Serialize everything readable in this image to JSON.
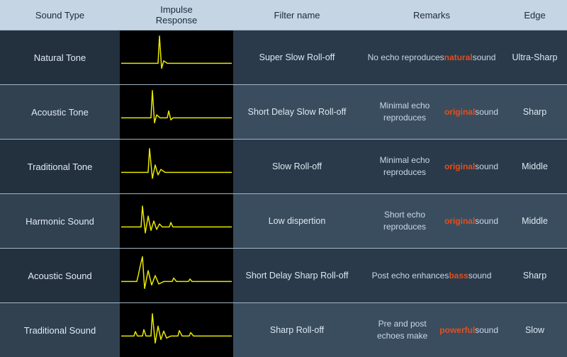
{
  "header": {
    "col1": "Sound Type",
    "col2": "Impulse\nResponse",
    "col3": "Filter name",
    "col4": "Remarks",
    "col5": "Edge"
  },
  "rows": [
    {
      "soundType": "Natural Tone",
      "filterName": "Super Slow Roll-off",
      "remarksPrefix": "No echo reproduces ",
      "remarksHighlight": "natural",
      "remarksSuffix": " sound",
      "highlightClass": "highlight-natural",
      "edge": "Ultra-Sharp",
      "impulseType": "natural"
    },
    {
      "soundType": "Acoustic Tone",
      "filterName": "Short Delay Slow Roll-off",
      "remarksPrefix": "Minimal echo reproduces ",
      "remarksHighlight": "original",
      "remarksSuffix": " sound",
      "highlightClass": "highlight-original",
      "edge": "Sharp",
      "impulseType": "acoustic-tone"
    },
    {
      "soundType": "Traditional Tone",
      "filterName": "Slow Roll-off",
      "remarksPrefix": "Minimal echo reproduces ",
      "remarksHighlight": "original",
      "remarksSuffix": " sound",
      "highlightClass": "highlight-original",
      "edge": "Middle",
      "impulseType": "traditional-tone"
    },
    {
      "soundType": "Harmonic Sound",
      "filterName": "Low dispertion",
      "remarksPrefix": "Short echo reproduces ",
      "remarksHighlight": "original",
      "remarksSuffix": " sound",
      "highlightClass": "highlight-original",
      "edge": "Middle",
      "impulseType": "harmonic"
    },
    {
      "soundType": "Acoustic Sound",
      "filterName": "Short Delay Sharp Roll-off",
      "remarksPrefix": "Post echo enhances ",
      "remarksHighlight": "bass",
      "remarksSuffix": " sound",
      "highlightClass": "highlight-bass",
      "edge": "Sharp",
      "impulseType": "acoustic-sound"
    },
    {
      "soundType": "Traditional Sound",
      "filterName": "Sharp Roll-off",
      "remarksPrefix": "Pre and post echoes make ",
      "remarksHighlight": "powerful",
      "remarksSuffix": " sound",
      "highlightClass": "highlight-powerful",
      "edge": "Slow",
      "impulseType": "traditional-sound"
    }
  ]
}
